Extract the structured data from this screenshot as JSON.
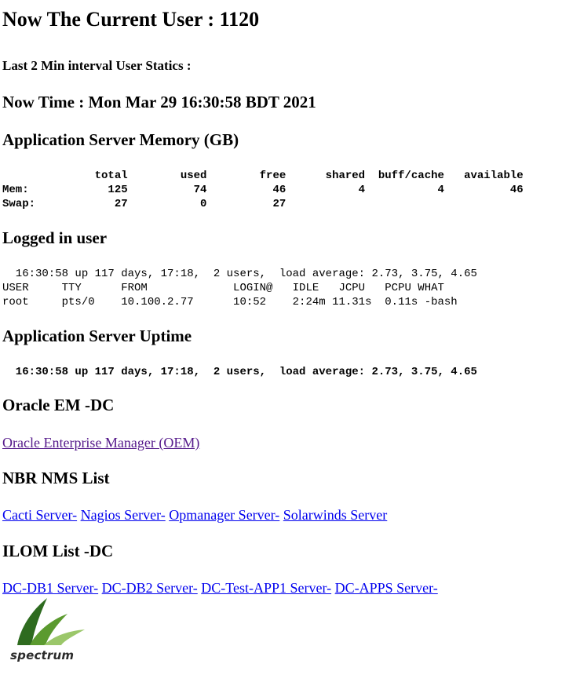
{
  "header": {
    "current_user": "Now The Current User : 1120",
    "interval_stats": "Last 2 Min interval User Statics :",
    "now_time": "Now Time : Mon Mar 29 16:30:58 BDT 2021"
  },
  "memory": {
    "heading": "Application Server Memory (GB)",
    "output": "              total        used        free      shared  buff/cache   available\nMem:            125          74          46           4           4          46\nSwap:            27           0          27"
  },
  "logged_in": {
    "heading": "Logged in user",
    "output": "  16:30:58 up 117 days, 17:18,  2 users,  load average: 2.73, 3.75, 4.65\nUSER     TTY      FROM             LOGIN@   IDLE   JCPU   PCPU WHAT\nroot     pts/0    10.100.2.77      10:52    2:24m 11.31s  0.11s -bash"
  },
  "uptime": {
    "heading": "Application Server Uptime",
    "output": "  16:30:58 up 117 days, 17:18,  2 users,  load average: 2.73, 3.75, 4.65"
  },
  "oracle_em": {
    "heading": "Oracle EM -DC",
    "link_oem": "Oracle Enterprise Manager (OEM)"
  },
  "nms": {
    "heading": "NBR NMS List",
    "links": [
      "Cacti Server-",
      "Nagios Server-",
      "Opmanager Server-",
      "Solarwinds Server"
    ]
  },
  "ilom": {
    "heading": "ILOM List -DC",
    "links": [
      "DC-DB1 Server-",
      "DC-DB2 Server-",
      "DC-Test-APP1 Server-",
      "DC-APPS Server-"
    ]
  },
  "logo": {
    "text": "spectrum",
    "colors": {
      "dark_green": "#2e6b1f",
      "mid_green": "#5b9a2f",
      "light_green": "#9bc76a"
    }
  },
  "colors": {
    "link": "#0000ee",
    "visited_link": "#551a8b",
    "background": "#ffffff",
    "text": "#000000"
  }
}
